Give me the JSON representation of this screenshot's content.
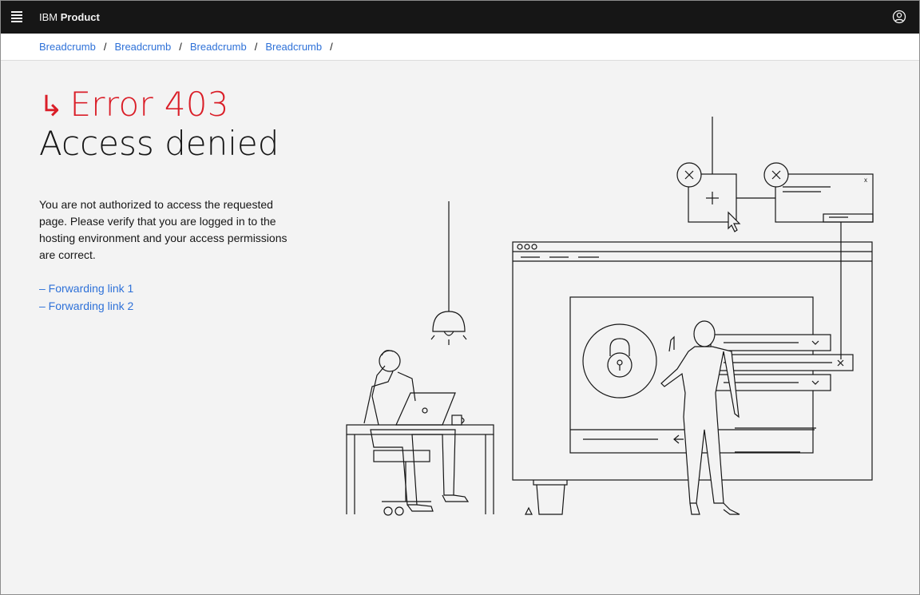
{
  "header": {
    "brand_prefix": "IBM",
    "brand_name": "Product",
    "menu_icon": "hamburger-menu-icon",
    "user_icon": "user-avatar-icon"
  },
  "breadcrumbs": [
    {
      "label": "Breadcrumb"
    },
    {
      "label": "Breadcrumb"
    },
    {
      "label": "Breadcrumb"
    },
    {
      "label": "Breadcrumb"
    }
  ],
  "breadcrumb_separator": "/",
  "error": {
    "arrow": "↳",
    "code": "Error 403",
    "title": "Access denied",
    "description": "You are not authorized to access the requested page. Please verify that you are logged in to the hosting environment and your access permissions are correct."
  },
  "links": [
    {
      "label": "– Forwarding link 1"
    },
    {
      "label": "– Forwarding link 2"
    }
  ],
  "colors": {
    "header_bg": "#161616",
    "error_red": "#da1e28",
    "link_blue": "#2e71d8",
    "page_bg": "#f3f3f3"
  }
}
